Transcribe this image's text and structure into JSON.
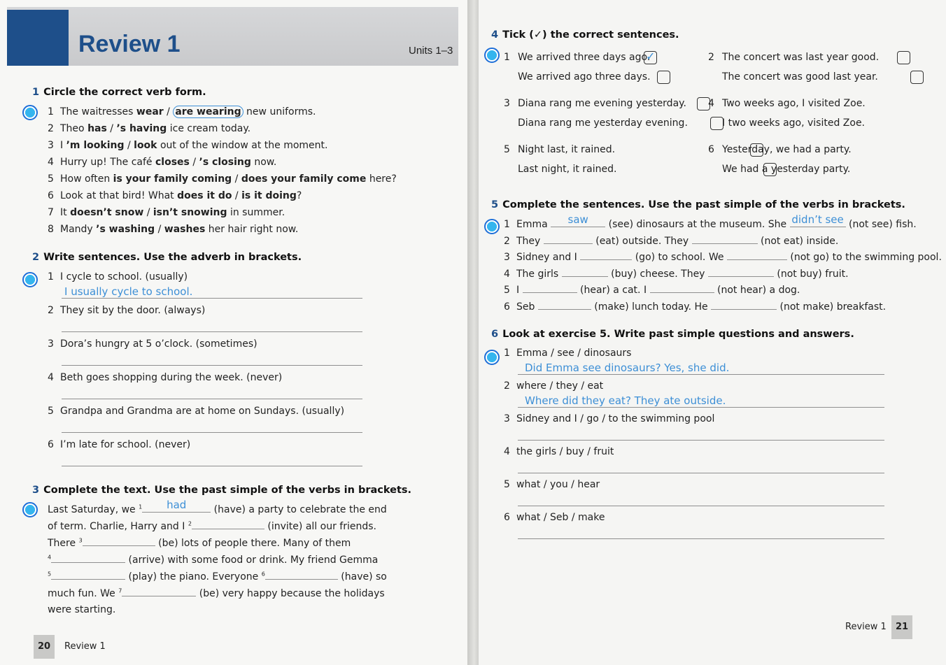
{
  "left_page": {
    "title": "Review 1",
    "units": "Units 1–3",
    "footer": {
      "number": "20",
      "label": "Review 1"
    },
    "ex1": {
      "num": "1",
      "title": "Circle the correct verb form.",
      "items": [
        {
          "n": "1",
          "pre": "The waitresses ",
          "a": "wear",
          "sep": " / ",
          "b": "are wearing",
          "post": " new uniforms."
        },
        {
          "n": "2",
          "pre": "Theo ",
          "a": "has",
          "sep": " / ",
          "b": "’s having",
          "post": " ice cream today."
        },
        {
          "n": "3",
          "pre": "I ",
          "a": "’m looking",
          "sep": " / ",
          "b": "look",
          "post": " out of the window at the moment."
        },
        {
          "n": "4",
          "pre": "Hurry up! The café ",
          "a": "closes",
          "sep": " / ",
          "b": "’s closing",
          "post": " now."
        },
        {
          "n": "5",
          "pre": "How often ",
          "a": "is your family coming",
          "sep": " / ",
          "b": "does your family come",
          "post": " here?"
        },
        {
          "n": "6",
          "pre": "Look at that bird! What ",
          "a": "does it do",
          "sep": " / ",
          "b": "is it doing",
          "post": "?"
        },
        {
          "n": "7",
          "pre": "It ",
          "a": "doesn’t snow",
          "sep": " / ",
          "b": "isn’t snowing",
          "post": " in summer."
        },
        {
          "n": "8",
          "pre": "Mandy ",
          "a": "’s washing",
          "sep": " / ",
          "b": "washes",
          "post": " her hair right now."
        }
      ]
    },
    "ex2": {
      "num": "2",
      "title": "Write sentences. Use the adverb in brackets.",
      "items": [
        {
          "n": "1",
          "text": "I cycle to school. (usually)",
          "answer": "I usually cycle to school."
        },
        {
          "n": "2",
          "text": "They sit by the door. (always)",
          "answer": ""
        },
        {
          "n": "3",
          "text": "Dora’s hungry at 5 o’clock. (sometimes)",
          "answer": ""
        },
        {
          "n": "4",
          "text": "Beth goes shopping during the week. (never)",
          "answer": ""
        },
        {
          "n": "5",
          "text": "Grandpa and Grandma are at home on Sundays. (usually)",
          "answer": ""
        },
        {
          "n": "6",
          "text": "I’m late for school. (never)",
          "answer": ""
        }
      ]
    },
    "ex3": {
      "num": "3",
      "title": "Complete the text. Use the past simple of the verbs in brackets.",
      "t1": "Last Saturday, we",
      "a1": "had",
      "t2": "(have) a party to celebrate the end",
      "t3": "of term. Charlie, Harry and I",
      "t4": "(invite) all our friends.",
      "t5": "There",
      "t6": "(be) lots of people there. Many of them",
      "t7": "(arrive) with some food or drink. My friend Gemma",
      "t8": "(play) the piano. Everyone",
      "t9": "(have) so",
      "t10": "much fun. We",
      "t11": "(be) very happy because the holidays",
      "t12": "were starting.",
      "sup": [
        "1",
        "2",
        "3",
        "4",
        "5",
        "6",
        "7"
      ]
    }
  },
  "right_page": {
    "footer": {
      "number": "21",
      "label": "Review 1"
    },
    "ex4": {
      "num": "4",
      "title": "Tick (✓) the correct sentences.",
      "tick": "✓",
      "pairs": [
        {
          "n": "1",
          "a": "We arrived three days ago.",
          "b": "We arrived ago three days.",
          "ticked": "a"
        },
        {
          "n": "2",
          "a": "The concert was last year good.",
          "b": "The concert was good last year.",
          "ticked": ""
        },
        {
          "n": "3",
          "a": "Diana rang me evening yesterday.",
          "b": "Diana rang me yesterday evening.",
          "ticked": ""
        },
        {
          "n": "4",
          "a": "Two weeks ago, I visited Zoe.",
          "b": "I two weeks ago, visited Zoe.",
          "ticked": ""
        },
        {
          "n": "5",
          "a": "Night last, it rained.",
          "b": "Last night, it rained.",
          "ticked": ""
        },
        {
          "n": "6",
          "a": "Yesterday, we had a party.",
          "b": "We had a yesterday party.",
          "ticked": ""
        }
      ]
    },
    "ex5": {
      "num": "5",
      "title": "Complete the sentences. Use the past simple of the verbs in brackets.",
      "items": [
        {
          "n": "1",
          "subj": "Emma",
          "a1": "saw",
          "v1": "(see) dinosaurs at the museum. She",
          "a2": "didn’t see",
          "v2": "(not see) fish."
        },
        {
          "n": "2",
          "subj": "They",
          "a1": "",
          "v1": "(eat) outside. They",
          "a2": "",
          "v2": "(not eat) inside."
        },
        {
          "n": "3",
          "subj": "Sidney and I",
          "a1": "",
          "v1": "(go) to school. We",
          "a2": "",
          "v2": "(not go) to the swimming pool."
        },
        {
          "n": "4",
          "subj": "The girls",
          "a1": "",
          "v1": "(buy) cheese. They",
          "a2": "",
          "v2": "(not buy) fruit."
        },
        {
          "n": "5",
          "subj": "I",
          "a1": "",
          "v1": "(hear) a cat. I",
          "a2": "",
          "v2": "(not hear) a dog."
        },
        {
          "n": "6",
          "subj": "Seb",
          "a1": "",
          "v1": "(make) lunch today. He",
          "a2": "",
          "v2": "(not make) breakfast."
        }
      ]
    },
    "ex6": {
      "num": "6",
      "title": "Look at exercise 5. Write past simple questions and answers.",
      "items": [
        {
          "n": "1",
          "prompt": "Emma / see / dinosaurs",
          "answer": "Did Emma see dinosaurs? Yes, she did."
        },
        {
          "n": "2",
          "prompt": "where / they / eat",
          "answer": "Where did they eat? They ate outside."
        },
        {
          "n": "3",
          "prompt": "Sidney and I / go / to the swimming pool",
          "answer": ""
        },
        {
          "n": "4",
          "prompt": "the girls / buy / fruit",
          "answer": ""
        },
        {
          "n": "5",
          "prompt": "what / you / hear",
          "answer": ""
        },
        {
          "n": "6",
          "prompt": "what / Seb / make",
          "answer": ""
        }
      ]
    }
  },
  "colors": {
    "title_blue": "#1e4f8a",
    "handwriting": "#3d8fd6",
    "marker": "#35b5ee"
  }
}
